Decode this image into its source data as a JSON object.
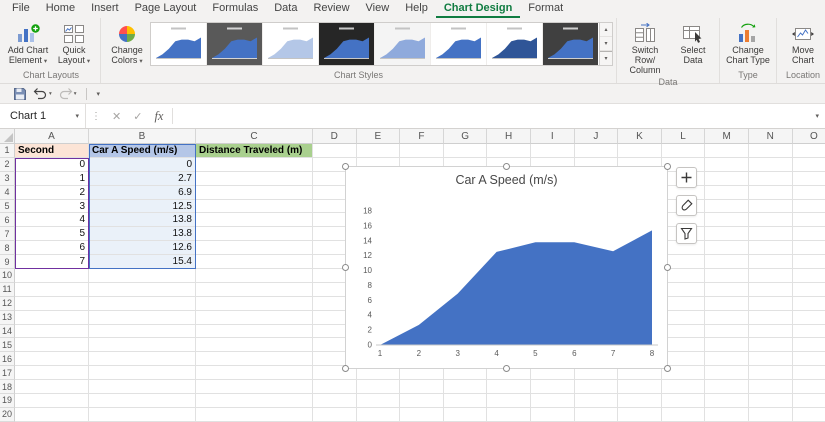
{
  "menubar": {
    "items": [
      "File",
      "Home",
      "Insert",
      "Page Layout",
      "Formulas",
      "Data",
      "Review",
      "View",
      "Help",
      "Chart Design",
      "Format"
    ],
    "active_item": "Chart Design"
  },
  "ribbon": {
    "chart_layouts": {
      "label": "Chart Layouts",
      "add_chart_element": "Add Chart Element",
      "quick_layout": "Quick Layout"
    },
    "chart_styles": {
      "label": "Chart Styles",
      "change_colors": "Change Colors",
      "styles": [
        {
          "name": "Style 1",
          "bg": "#ffffff",
          "area": "#4472c4",
          "selected": true
        },
        {
          "name": "Style 2",
          "bg": "#595959",
          "area": "#4472c4",
          "selected": false
        },
        {
          "name": "Style 3",
          "bg": "#ffffff",
          "area": "#b4c7e7",
          "selected": false
        },
        {
          "name": "Style 4",
          "bg": "#262626",
          "area": "#4472c4",
          "selected": false
        },
        {
          "name": "Style 5",
          "bg": "#f4f4f4",
          "area": "#8faadc",
          "selected": false
        },
        {
          "name": "Style 6",
          "bg": "#ffffff",
          "area": "#4472c4",
          "selected": false
        },
        {
          "name": "Style 7",
          "bg": "#ffffff",
          "area": "#2f5597",
          "selected": false
        },
        {
          "name": "Style 8",
          "bg": "#404040",
          "area": "#4472c4",
          "selected": false
        }
      ]
    },
    "data_group": {
      "label": "Data",
      "switch_row_column": "Switch Row/ Column",
      "select_data": "Select Data"
    },
    "type_group": {
      "label": "Type",
      "change_chart_type": "Change Chart Type"
    },
    "location_group": {
      "label": "Location",
      "move_chart": "Move Chart"
    }
  },
  "name_box": {
    "value": "Chart 1"
  },
  "formula_bar": {
    "value": ""
  },
  "icons": {
    "dropdown": "▾",
    "scroll_up": "▴",
    "scroll_down": "▾",
    "cancel": "✕",
    "enter": "✓",
    "fx": "fx",
    "resize_dots": "⋮",
    "expand": "▾"
  },
  "sheet": {
    "columns": [
      "A",
      "B",
      "C",
      "D",
      "E",
      "F",
      "G",
      "H",
      "I",
      "J",
      "K",
      "L",
      "M",
      "N",
      "O"
    ],
    "rows": [
      "1",
      "2",
      "3",
      "4",
      "5",
      "6",
      "7",
      "8",
      "9",
      "10",
      "11",
      "12",
      "13",
      "14",
      "15",
      "16",
      "17",
      "18",
      "19",
      "20"
    ],
    "cells": {
      "A1": "Second",
      "B1": "Car A Speed (m/s)",
      "C1": "Distance Traveled (m)",
      "A2": "0",
      "B2": "0",
      "A3": "1",
      "B3": "2.7",
      "A4": "2",
      "B4": "6.9",
      "A5": "3",
      "B5": "12.5",
      "A6": "4",
      "B6": "13.8",
      "A7": "5",
      "B7": "13.8",
      "A8": "6",
      "B8": "12.6",
      "A9": "7",
      "B9": "15.4"
    },
    "header_fills": {
      "A1": "#FCE4D6",
      "B1": "#B4C6E7",
      "C1": "#A9D08E"
    }
  },
  "chart_data": {
    "type": "area",
    "title": "Car A Speed (m/s)",
    "categories": [
      1,
      2,
      3,
      4,
      5,
      6,
      7,
      8
    ],
    "values": [
      0,
      2.7,
      6.9,
      12.5,
      13.8,
      13.8,
      12.6,
      15.4
    ],
    "xlabel": "",
    "ylabel": "",
    "ylim": [
      0,
      18
    ],
    "ytick_step": 2,
    "fill_color": "#4472C4",
    "legend": "none",
    "grid": false
  },
  "colors": {
    "accent_green": "#107C41",
    "selection_blue": "#4472C4",
    "selection_purple": "#7030A0",
    "area_fill": "#4472C4"
  }
}
